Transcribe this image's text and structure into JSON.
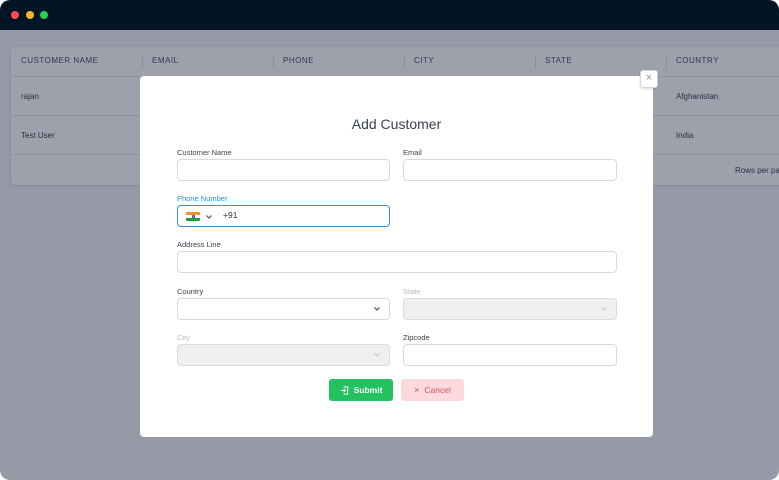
{
  "window": {
    "controls": [
      "close",
      "minimize",
      "maximize"
    ]
  },
  "table": {
    "columns": [
      "CUSTOMER NAME",
      "EMAIL",
      "PHONE",
      "CITY",
      "STATE",
      "COUNTRY"
    ],
    "rows": [
      {
        "name": "rajan",
        "country": "Afghanistan"
      },
      {
        "name": "Test User",
        "country": "India"
      }
    ],
    "footer": "Rows per pa"
  },
  "modal": {
    "title": "Add Customer",
    "close_icon": "×",
    "fields": {
      "customer_name": {
        "label": "Customer Name",
        "value": ""
      },
      "email": {
        "label": "Email",
        "value": ""
      },
      "phone": {
        "label": "Phone Number",
        "value": "+91",
        "country_flag": "india-flag-icon"
      },
      "address": {
        "label": "Address Line",
        "value": ""
      },
      "country": {
        "label": "Country",
        "value": ""
      },
      "state": {
        "label": "State",
        "value": "",
        "disabled": true
      },
      "city": {
        "label": "City",
        "value": "",
        "disabled": true
      },
      "zipcode": {
        "label": "Zipcode",
        "value": ""
      }
    },
    "submit_label": "Submit",
    "submit_icon": "login-icon",
    "cancel_label": "Cancel",
    "cancel_icon": "×"
  },
  "colors": {
    "titlebar": "#031524",
    "submit": "#22c35e",
    "cancel_bg": "#fbd9dc",
    "cancel_text": "#e0505e",
    "focus": "#2d8fd6"
  }
}
